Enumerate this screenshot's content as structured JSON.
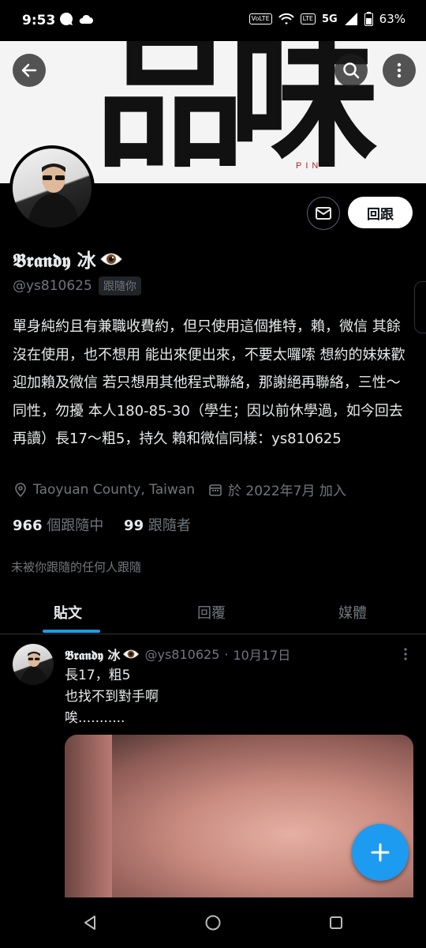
{
  "status": {
    "time": "9:53",
    "volte": "VoLTE",
    "lte": "LTE",
    "network": "5G",
    "battery": "63%"
  },
  "banner": {
    "text": "品味",
    "pin_text": "PIN"
  },
  "profile": {
    "display_name": "𝕭𝖗𝖆𝖓𝖉𝖞 冰",
    "handle": "@ys810625",
    "follows_you": "跟隨你",
    "follow_label": "回跟",
    "bio": "單身純約且有兼職收費約，但只使用這個推特，賴，微信 其餘沒在使用，也不想用 能出來便出來，不要太囉嗦 想約的妹妹歡迎加賴及微信 若只想用其他程式聯絡，那謝絕再聯絡，三性～同性，勿擾 本人180-85-30（學生；因以前休學過，如今回去再讀）長17～粗5，持久 賴和微信同樣：ys810625",
    "location": "Taoyuan County, Taiwan",
    "joined": "於 2022年7月 加入",
    "following_count": "966",
    "following_label": " 個跟隨中",
    "followers_count": "99",
    "followers_label": " 跟隨者",
    "followed_by_note": "未被你跟隨的任何人跟隨"
  },
  "tabs": [
    {
      "label": "貼文",
      "active": true
    },
    {
      "label": "回覆",
      "active": false
    },
    {
      "label": "媒體",
      "active": false
    }
  ],
  "tweet": {
    "name": "𝕭𝖗𝖆𝖓𝖉𝖞 冰",
    "handle": "@ys810625",
    "separator": "·",
    "date": "10月17日",
    "text": "長17，粗5\n也找不到對手啊\n唉..........."
  },
  "colors": {
    "accent": "#1d9bf0",
    "background": "#000000",
    "text": "#e7e9ea",
    "muted": "#71767b"
  }
}
